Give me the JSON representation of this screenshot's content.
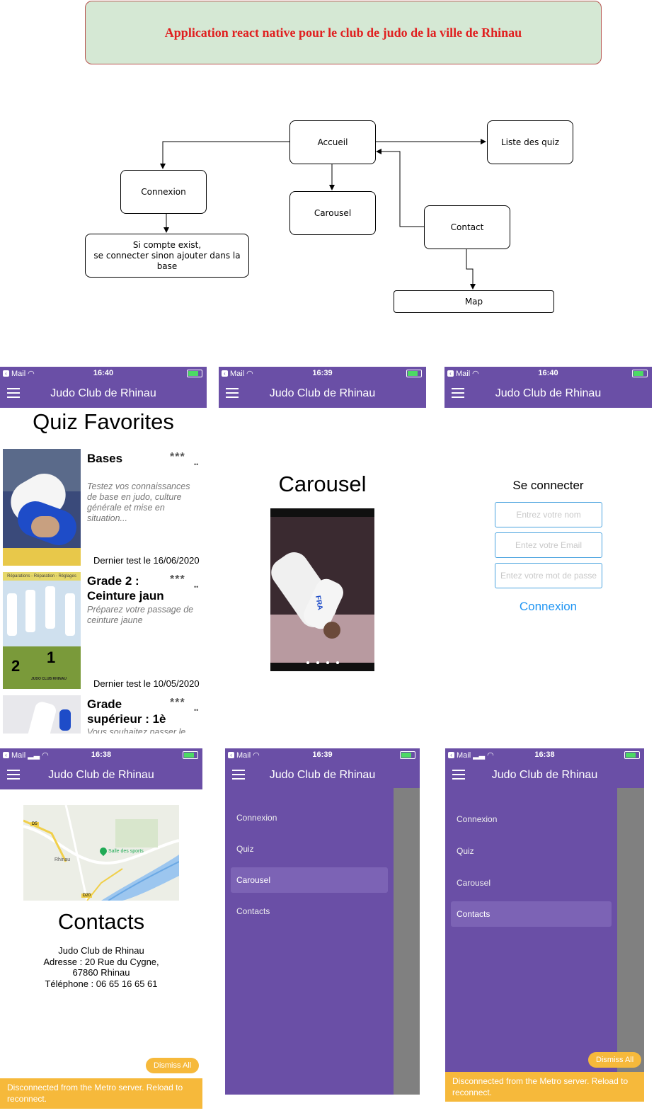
{
  "header": {
    "title": "Application react native pour le club de judo de la ville de Rhinau"
  },
  "diagram": {
    "nodes": {
      "accueil": "Accueil",
      "liste_quiz": "Liste des quiz",
      "connexion": "Connexion",
      "carousel": "Carousel",
      "contact": "Contact",
      "compte_line1": "Si compte exist,",
      "compte_line2": "se connecter sinon ajouter dans la base",
      "map": "Map"
    }
  },
  "statusbar": {
    "carrier": "Mail",
    "time_quiz": "16:40",
    "time_carousel": "16:39",
    "time_login": "16:40",
    "time_contacts": "16:38",
    "time_drawer1": "16:39",
    "time_drawer2": "16:38"
  },
  "app": {
    "title": "Judo Club de Rhinau"
  },
  "quiz_screen": {
    "heading": "Quiz Favorites",
    "items": [
      {
        "title": "Bases",
        "stars": "***",
        "desc": "Testez vos connaissances de base en judo, culture générale et mise en situation...",
        "date": "Dernier test le 16/06/2020"
      },
      {
        "title": "Grade 2 : Ceinture jaun",
        "stars": "***",
        "desc": "Préparez votre passage de ceinture jaune",
        "date": "Dernier test le 10/05/2020"
      },
      {
        "title": "Grade supérieur : 1è",
        "stars": "***",
        "desc": "Vous souhaitez passer le",
        "date": ""
      }
    ],
    "photo2_text": {
      "top": "Réparations - Réparation - Réglages",
      "rank1": "1",
      "rank2": "2",
      "club": "JUDO CLUB RHINAU"
    }
  },
  "carousel_screen": {
    "heading": "Carousel",
    "dots": 4,
    "photo_text": "FRA"
  },
  "login_screen": {
    "heading": "Se connecter",
    "name_placeholder": "Entrez votre nom",
    "email_placeholder": "Entez votre Email",
    "password_placeholder": "Entez votre mot de passe",
    "submit": "Connexion"
  },
  "contacts_screen": {
    "map_labels": {
      "town": "Rhinau",
      "poi": "Salle des sports",
      "road1": "D5",
      "road2": "D20"
    },
    "heading": "Contacts",
    "lines": [
      "Judo Club de Rhinau",
      "Adresse : 20 Rue du Cygne,",
      "67860 Rhinau",
      "Téléphone : 06 65 16 65 61"
    ]
  },
  "drawer": {
    "items": [
      "Connexion",
      "Quiz",
      "Carousel",
      "Contacts"
    ],
    "active_left": "Carousel",
    "active_right": "Contacts"
  },
  "metro": {
    "dismiss": "Dismiss All",
    "banner": "Disconnected from the Metro server. Reload to reconnect."
  },
  "colors": {
    "primary": "#6a4fa6",
    "banner": "#f6b93b",
    "link": "#2196f3",
    "title_fill": "#d5e8d4",
    "title_text": "#e02020"
  }
}
